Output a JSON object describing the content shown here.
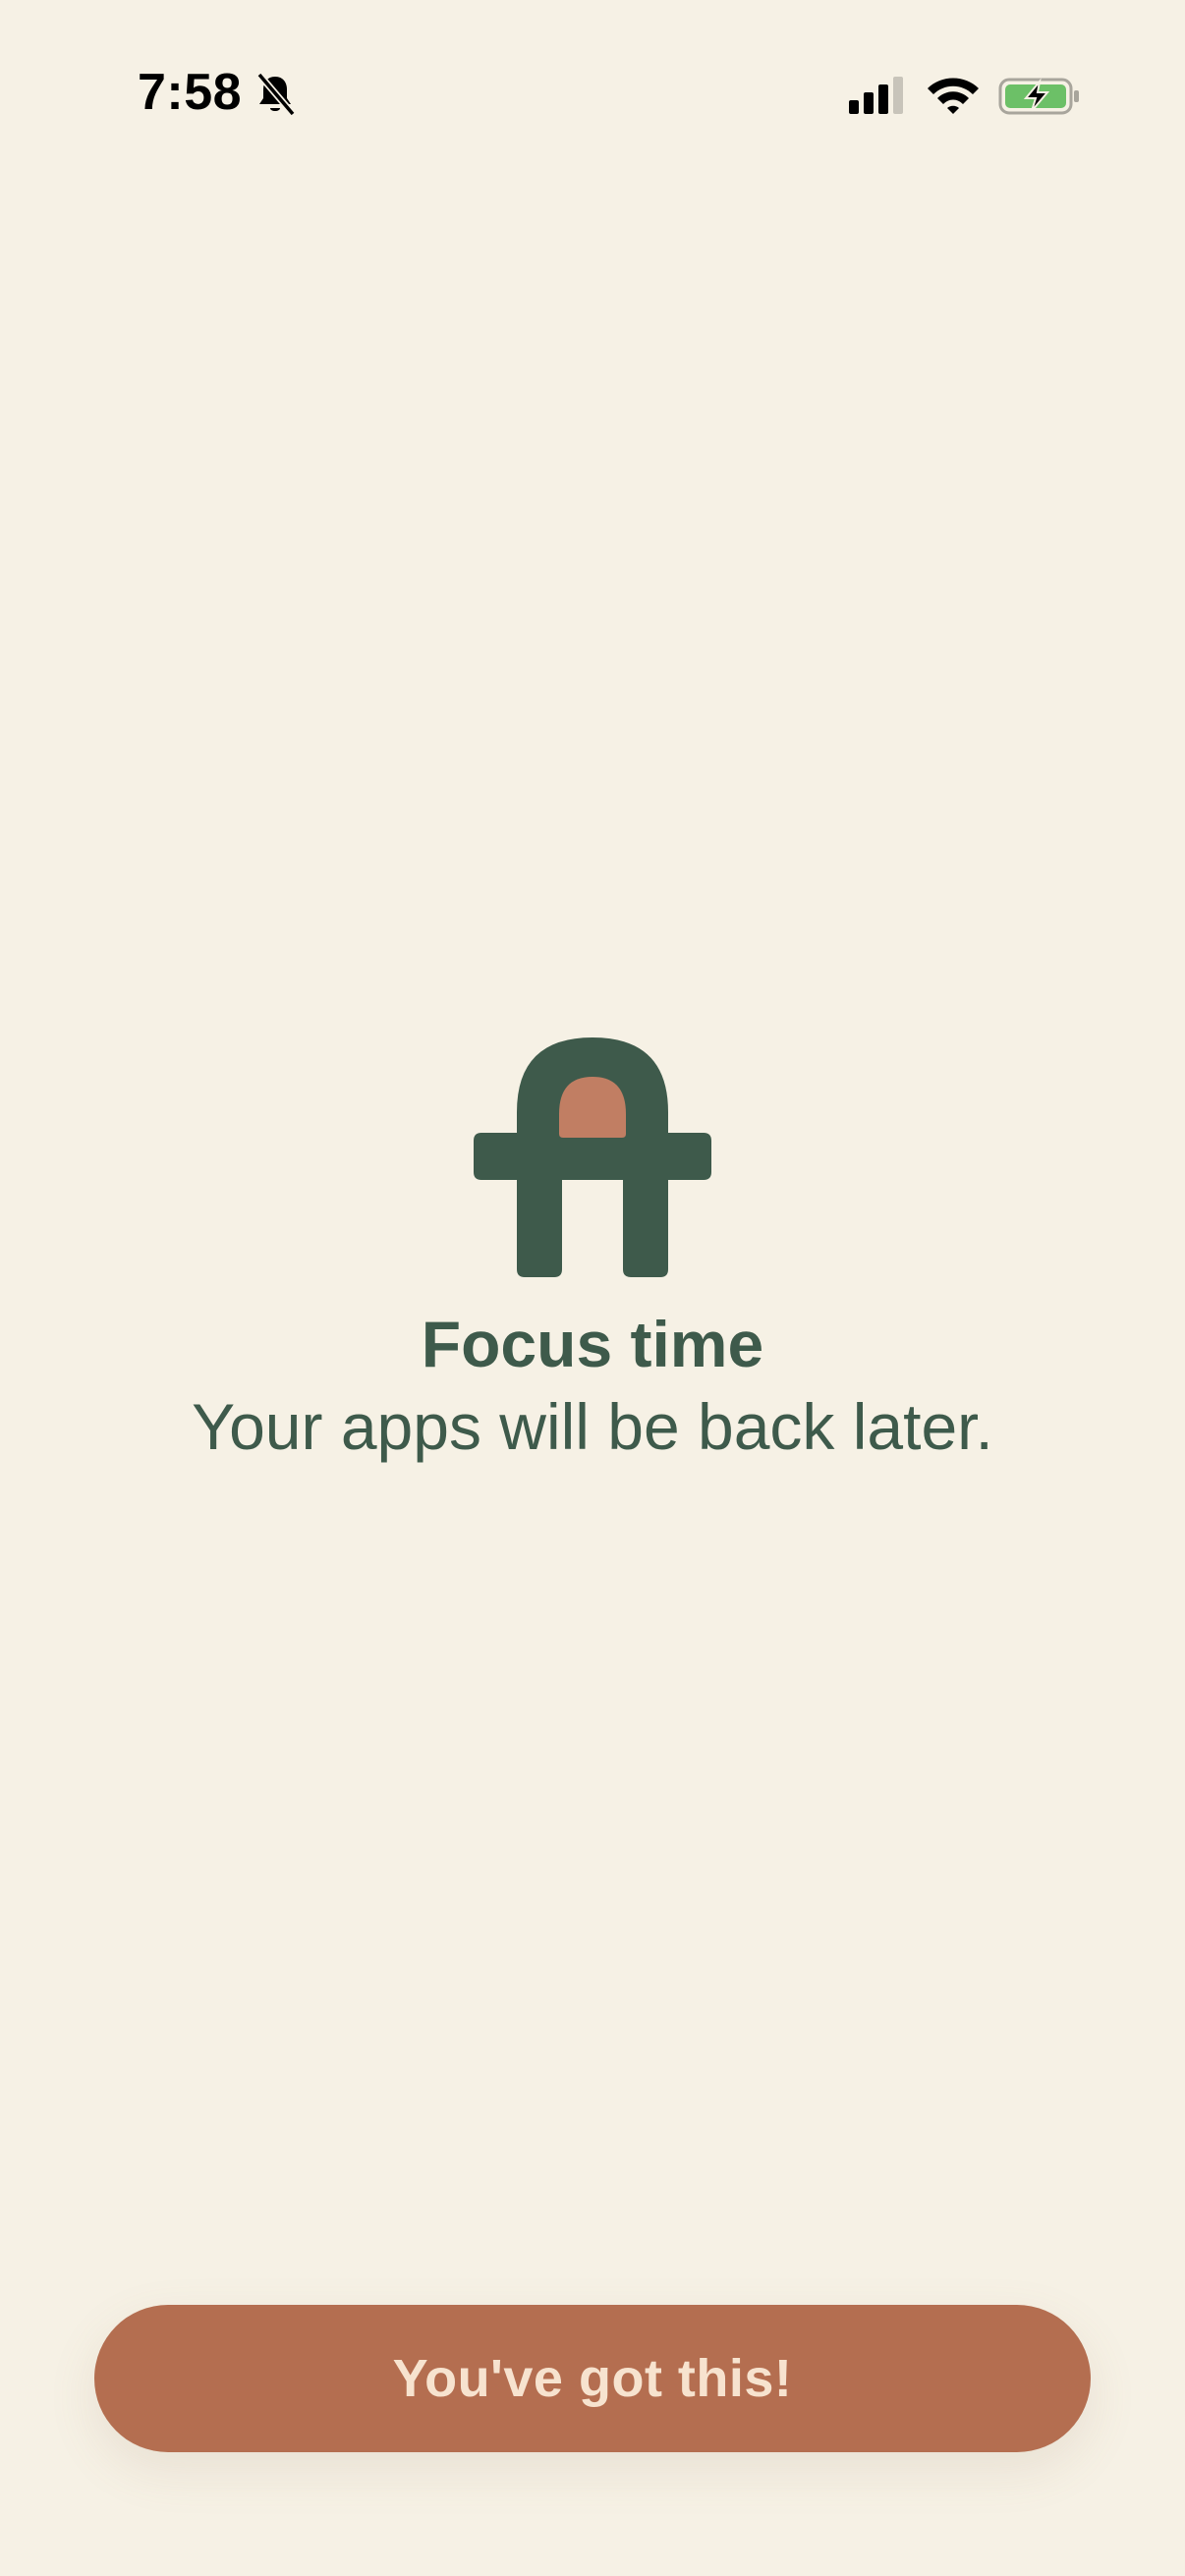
{
  "status_bar": {
    "time": "7:58",
    "icons": [
      "bell-muted-icon",
      "cellular-signal-icon",
      "wifi-icon",
      "battery-charging-icon"
    ]
  },
  "focus_screen": {
    "logo_icon": "arch-logo-icon",
    "title": "Focus time",
    "subtitle": "Your apps will be back later.",
    "button_label": "You've got this!"
  },
  "colors": {
    "background": "#F6F1E5",
    "text": "#3E5A4B",
    "logo_green": "#3E5A4B",
    "logo_accent": "#C17E63",
    "button": "#B46E50",
    "button_text": "#F7E3CF",
    "battery_fill": "#6CC067"
  }
}
